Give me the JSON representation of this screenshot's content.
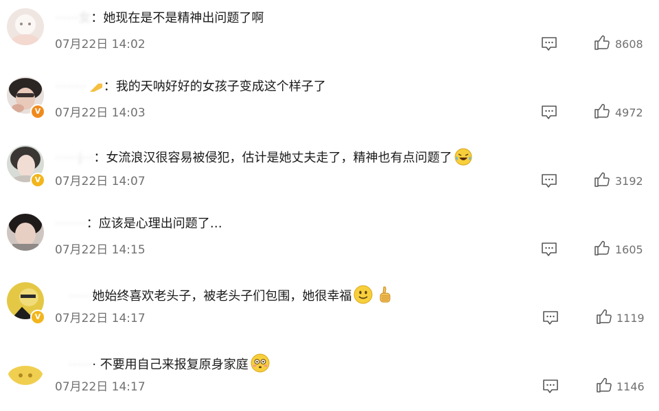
{
  "comments": [
    {
      "user": "······女",
      "text": "她现在是不是精神出问题了啊",
      "time": "07月22日 14:02",
      "likes": "8608"
    },
    {
      "user": "········",
      "text": "我的天呐好好的女孩子变成这个样子了",
      "time": "07月22日 14:03",
      "likes": "4972"
    },
    {
      "user": "······j···",
      "text": "女流浪汉很容易被侵犯，估计是她丈夫走了，精神也有点问题了",
      "time": "07月22日 14:07",
      "likes": "3192"
    },
    {
      "user": "········",
      "text": "应该是心理出问题了…",
      "time": "07月22日 14:15",
      "likes": "1605"
    },
    {
      "user": "······",
      "text": "她始终喜欢老头子，被老头子们包围，她很幸福",
      "time": "07月22日 14:17",
      "likes": "1119"
    },
    {
      "user": "······",
      "text": "不要用自己来报复原身家庭",
      "time": "07月22日 14:17",
      "likes": "1146"
    }
  ],
  "separator": "：",
  "icons": {
    "reply": "comment-icon",
    "like": "thumbs-up-icon",
    "verified": "v-badge-icon"
  },
  "colors": {
    "text": "#1a1a1a",
    "meta": "#707070",
    "badge_orange": "#f08a1d",
    "badge_gold": "#f2b51b"
  }
}
